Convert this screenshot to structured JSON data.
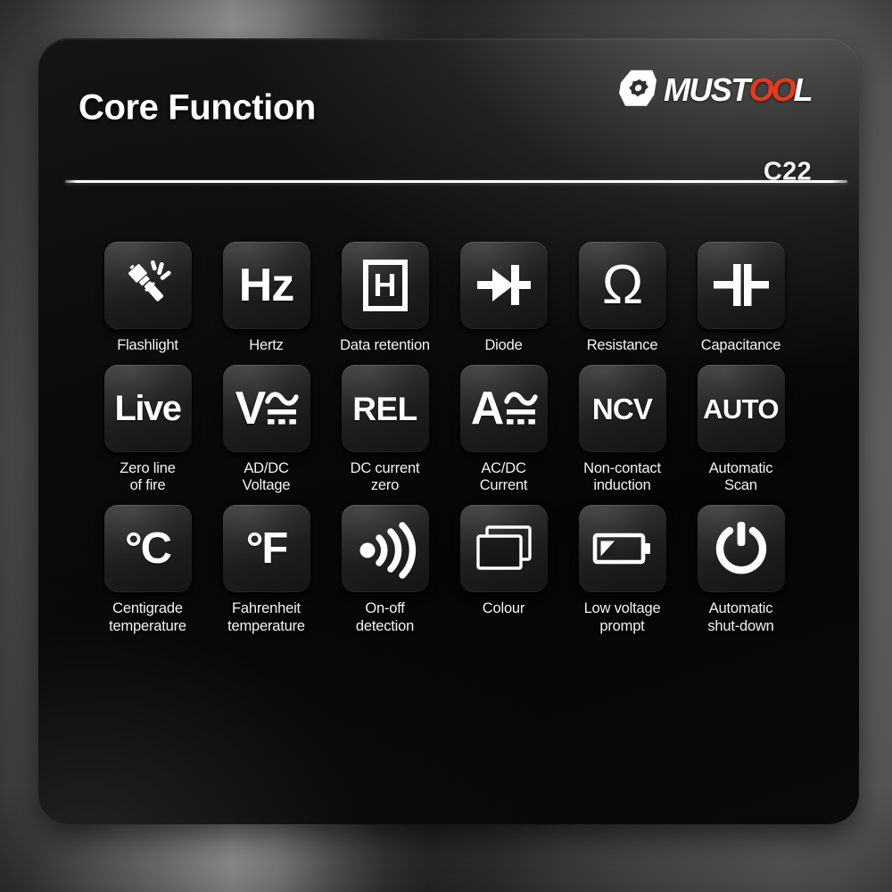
{
  "header": {
    "title": "Core Function",
    "brand_name": "MUSTOOL",
    "brand_name_prefix": "MUST",
    "brand_name_oo": "OO",
    "brand_name_suffix": "L",
    "model_code": "C22",
    "brand_mark_icon": "hex-gear-logo-icon",
    "accent_color": "#e8391a"
  },
  "grid": {
    "rows": 3,
    "columns": 6,
    "items": [
      {
        "icon": "flashlight-icon",
        "glyph": "",
        "label": "Flashlight"
      },
      {
        "icon": "hertz-icon",
        "glyph": "Hz",
        "label": "Hertz"
      },
      {
        "icon": "data-hold-icon",
        "glyph": "H",
        "label": "Data retention"
      },
      {
        "icon": "diode-icon",
        "glyph": "",
        "label": "Diode"
      },
      {
        "icon": "resistance-omega-icon",
        "glyph": "Ω",
        "label": "Resistance"
      },
      {
        "icon": "capacitance-icon",
        "glyph": "",
        "label": "Capacitance"
      },
      {
        "icon": "live-wire-icon",
        "glyph": "Live",
        "label": "Zero line\nof fire"
      },
      {
        "icon": "voltage-acdc-icon",
        "glyph": "V",
        "label": "AD/DC\nVoltage"
      },
      {
        "icon": "relative-zero-icon",
        "glyph": "REL",
        "label": "DC current\nzero"
      },
      {
        "icon": "current-acdc-icon",
        "glyph": "A",
        "label": "AC/DC\nCurrent"
      },
      {
        "icon": "ncv-icon",
        "glyph": "NCV",
        "label": "Non-contact\ninduction"
      },
      {
        "icon": "auto-range-icon",
        "glyph": "AUTO",
        "label": "Automatic\nScan"
      },
      {
        "icon": "celsius-icon",
        "glyph": "°C",
        "label": "Centigrade\ntemperature"
      },
      {
        "icon": "fahrenheit-icon",
        "glyph": "°F",
        "label": "Fahrenheit\ntemperature"
      },
      {
        "icon": "continuity-signal-icon",
        "glyph": "",
        "label": "On-off\ndetection"
      },
      {
        "icon": "colour-screen-icon",
        "glyph": "",
        "label": "Colour"
      },
      {
        "icon": "low-battery-icon",
        "glyph": "",
        "label": "Low voltage\nprompt"
      },
      {
        "icon": "power-off-icon",
        "glyph": "",
        "label": "Automatic\nshut-down"
      }
    ]
  }
}
